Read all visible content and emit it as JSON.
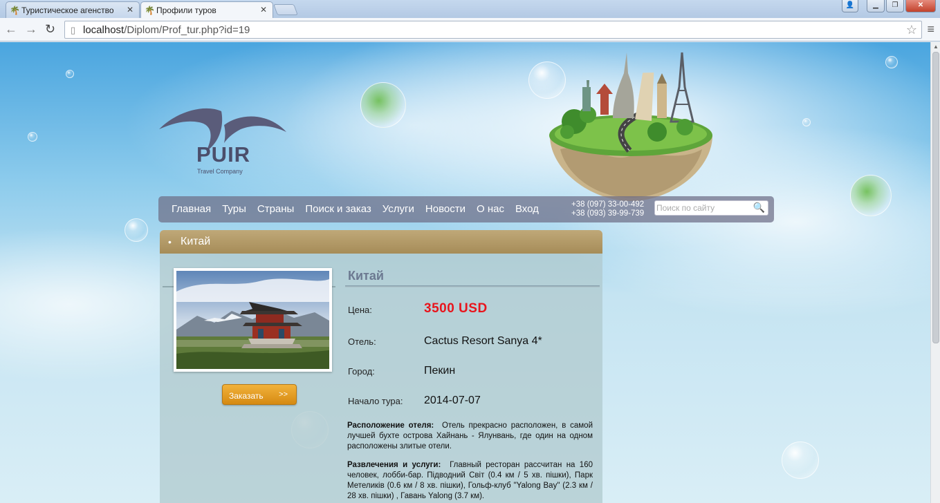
{
  "browser": {
    "tabs": [
      {
        "title": "Туристическое агенство",
        "active": false
      },
      {
        "title": "Профили туров",
        "active": true
      }
    ],
    "url_host": "localhost",
    "url_path": "/Diplom/Prof_tur.php?id=19"
  },
  "logo": {
    "name": "PUIR",
    "tagline": "Travel Company"
  },
  "nav": {
    "items": [
      "Главная",
      "Туры",
      "Страны",
      "Поиск и заказ",
      "Услуги",
      "Новости",
      "О нас",
      "Вход"
    ],
    "phone1": "+38 (097) 33-00-492",
    "phone2": "+38 (093) 39-99-739",
    "search_placeholder": "Поиск по сайту"
  },
  "section": {
    "title": "Китай"
  },
  "tour": {
    "title": "Китай",
    "order_label": "Заказать",
    "order_arrows": ">>",
    "fields": {
      "price_label": "Цена:",
      "price_value": "3500 USD",
      "hotel_label": "Отель:",
      "hotel_value": "Cactus Resort Sanya 4*",
      "city_label": "Город:",
      "city_value": "Пекин",
      "start_label": "Начало тура:",
      "start_value": "2014-07-07"
    },
    "location_label": "Расположение отеля:",
    "location_text": "Отель прекрасно расположен, в самой лучшей бухте острова Хайнань - Ялунвань, где один на одном расположены злитые отели.",
    "entertainment_label": "Развлечения и услуги:",
    "entertainment_text": "Главный ресторан рассчитан на 160 человек, лобби-бар. Підводний Світ (0.4 км / 5 хв. пішки), Парк Метеликів (0.6 км / 8 хв. пішки), Гольф-клуб \"Yalong Bay\" (2.3 км / 28 хв. пішки) , Гавань Yalong (3.7 км)."
  },
  "colors": {
    "price": "#e8141c",
    "header": "#a68c58",
    "button": "#e39a1f",
    "navbar": "#6e6e87"
  }
}
